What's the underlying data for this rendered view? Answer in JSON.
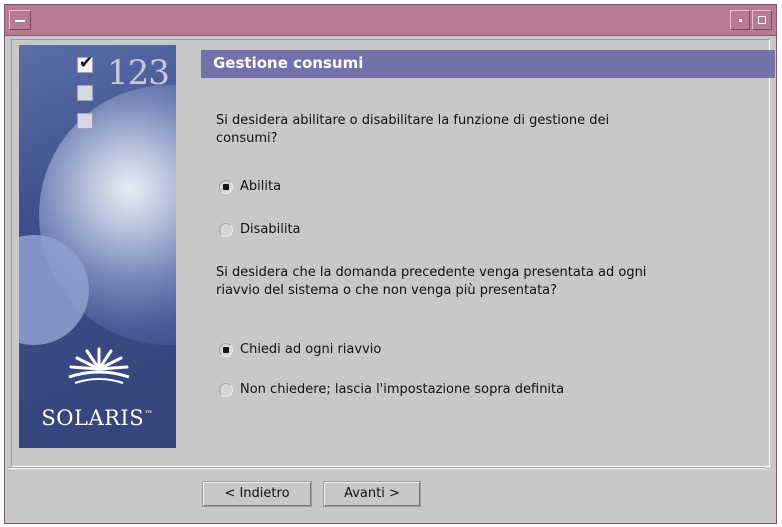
{
  "side_panel": {
    "steps_text": "123",
    "logo_text": "SOLARIS",
    "trademark": "™"
  },
  "section": {
    "title": "Gestione consumi"
  },
  "question1": {
    "text_line1": "Si desidera abilitare o disabilitare la funzione di gestione dei",
    "text_line2": "consumi?",
    "options": [
      {
        "label": "Abilita",
        "selected": true
      },
      {
        "label": "Disabilita",
        "selected": false
      }
    ]
  },
  "question2": {
    "text_line1": "Si desidera che la domanda precedente venga presentata ad ogni",
    "text_line2": "riavvio del sistema o che non venga più presentata?",
    "options": [
      {
        "label": "Chiedi ad ogni riavvio",
        "selected": true
      },
      {
        "label": "Non chiedere; lascia l'impostazione sopra definita",
        "selected": false
      }
    ]
  },
  "buttons": {
    "back": "< Indietro",
    "next": "Avanti >"
  },
  "colors": {
    "titlebar": "#b67b92",
    "section_header": "#7372a8",
    "background": "#c8c8c8"
  }
}
